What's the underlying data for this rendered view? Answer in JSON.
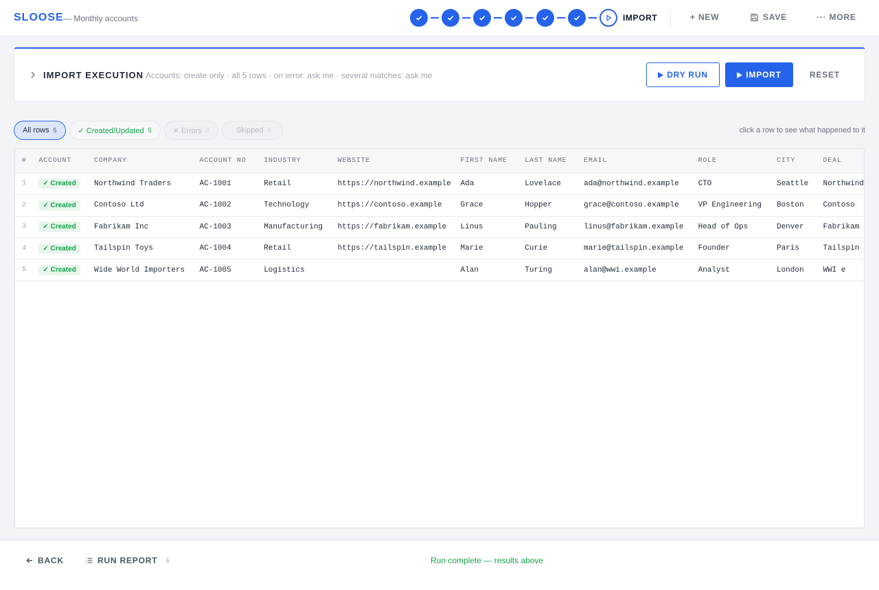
{
  "header": {
    "brand": "SLOOSE",
    "subtitle": "— Monthly accounts",
    "current_step_label": "IMPORT",
    "new_label": "+ NEW",
    "save_label": "SAVE",
    "more_label": "··· MORE"
  },
  "stepper": {
    "completed_steps": 6,
    "total_steps": 7,
    "current_step": 7
  },
  "panel": {
    "title": "IMPORT EXECUTION",
    "summary": "Accounts: create only · all 5 rows · on error: ask me · several matches: ask me",
    "dry_run_label": "DRY RUN",
    "import_label": "IMPORT",
    "reset_label": "RESET"
  },
  "filters": {
    "all": {
      "label": "All rows",
      "count": "5"
    },
    "created": {
      "label": "✓ Created/Updated",
      "count": "5"
    },
    "errors": {
      "label": "✕ Errors",
      "count": "0"
    },
    "skipped": {
      "label": "Skipped",
      "count": "0"
    },
    "hint": "click a row to see what happened to it"
  },
  "table": {
    "columns": [
      "#",
      "ACCOUNT",
      "COMPANY",
      "ACCOUNT NO",
      "INDUSTRY",
      "WEBSITE",
      "FIRST NAME",
      "LAST NAME",
      "EMAIL",
      "ROLE",
      "CITY",
      "DEAL"
    ],
    "rows": [
      {
        "num": "1",
        "status": "✓ Created",
        "company": "Northwind Traders",
        "account_no": "AC-1001",
        "industry": "Retail",
        "website": "https://northwind.example",
        "first": "Ada",
        "last": "Lovelace",
        "email": "ada@northwind.example",
        "role": "CTO",
        "city": "Seattle",
        "deal": "Northwind"
      },
      {
        "num": "2",
        "status": "✓ Created",
        "company": "Contoso Ltd",
        "account_no": "AC-1002",
        "industry": "Technology",
        "website": "https://contoso.example",
        "first": "Grace",
        "last": "Hopper",
        "email": "grace@contoso.example",
        "role": "VP Engineering",
        "city": "Boston",
        "deal": "Contoso"
      },
      {
        "num": "3",
        "status": "✓ Created",
        "company": "Fabrikam Inc",
        "account_no": "AC-1003",
        "industry": "Manufacturing",
        "website": "https://fabrikam.example",
        "first": "Linus",
        "last": "Pauling",
        "email": "linus@fabrikam.example",
        "role": "Head of Ops",
        "city": "Denver",
        "deal": "Fabrikam"
      },
      {
        "num": "4",
        "status": "✓ Created",
        "company": "Tailspin Toys",
        "account_no": "AC-1004",
        "industry": "Retail",
        "website": "https://tailspin.example",
        "first": "Marie",
        "last": "Curie",
        "email": "marie@tailspin.example",
        "role": "Founder",
        "city": "Paris",
        "deal": "Tailspin"
      },
      {
        "num": "5",
        "status": "✓ Created",
        "company": "Wide World Importers",
        "account_no": "AC-1005",
        "industry": "Logistics",
        "website": "",
        "first": "Alan",
        "last": "Turing",
        "email": "alan@wwi.example",
        "role": "Analyst",
        "city": "London",
        "deal": "WWI e"
      }
    ]
  },
  "footer": {
    "back_label": "BACK",
    "run_report_label": "RUN REPORT",
    "run_report_count": "6",
    "status": "Run complete — results above"
  },
  "colors": {
    "accent": "#2563eb",
    "success": "#16a34a",
    "background": "#f3f4f7"
  },
  "icons": [
    "check-icon",
    "play-icon",
    "plus-icon",
    "save-icon",
    "more-icon",
    "chevron-right-icon",
    "arrow-left-icon",
    "list-icon"
  ]
}
